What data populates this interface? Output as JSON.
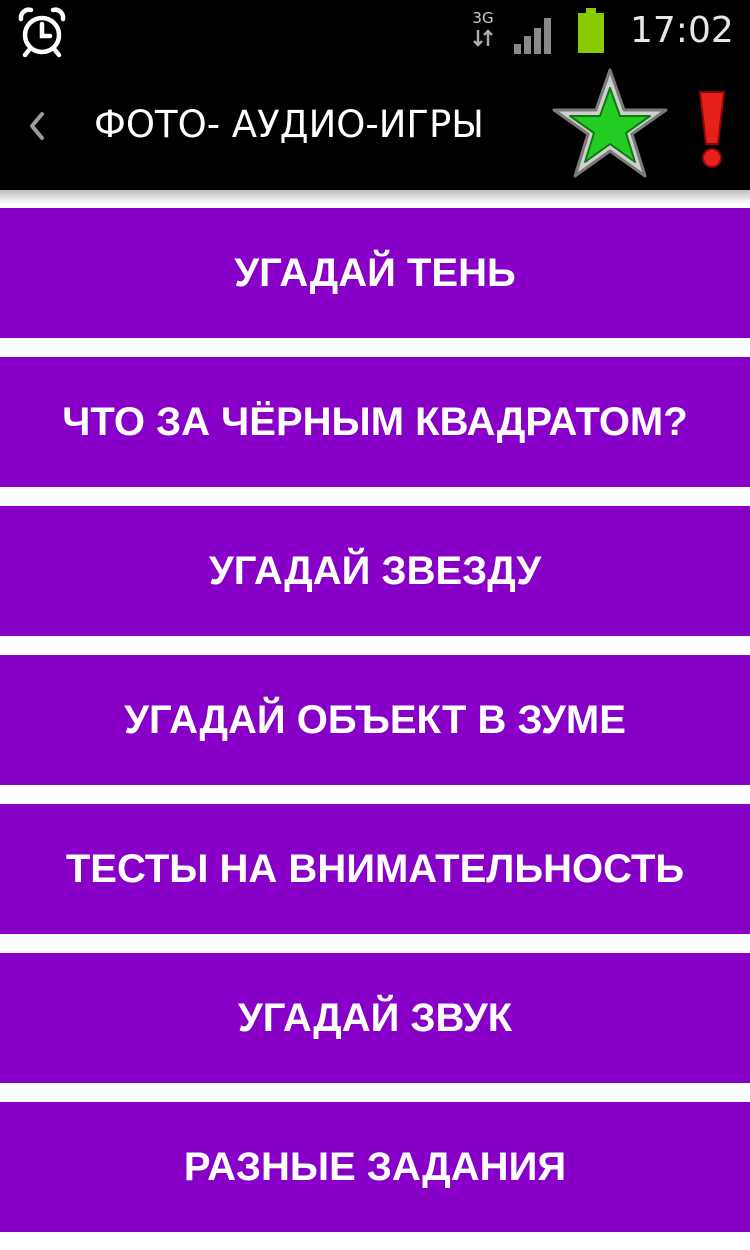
{
  "status_bar": {
    "network_type": "3G",
    "time": "17:02",
    "icons": [
      "alarm-icon",
      "data-arrows-icon",
      "signal-icon",
      "battery-icon"
    ]
  },
  "action_bar": {
    "title": "ФОТО- АУДИО-ИГРЫ",
    "icons": [
      "back-chevron-icon",
      "star-icon",
      "exclamation-icon"
    ]
  },
  "menu": {
    "items": [
      {
        "label": "УГАДАЙ ТЕНЬ"
      },
      {
        "label": "ЧТО ЗА ЧЁРНЫМ КВАДРАТОМ?"
      },
      {
        "label": "УГАДАЙ ЗВЕЗДУ"
      },
      {
        "label": "УГАДАЙ ОБЪЕКТ В ЗУМЕ"
      },
      {
        "label": "ТЕСТЫ НА ВНИМАТЕЛЬНОСТЬ"
      },
      {
        "label": "УГАДАЙ ЗВУК"
      },
      {
        "label": "РАЗНЫЕ ЗАДАНИЯ"
      }
    ]
  },
  "colors": {
    "menu_background": "#8800c8",
    "menu_text": "#ffffff",
    "bar_background": "#000000",
    "star_fill": "#22cc22",
    "alert_red": "#e8201a",
    "battery_green": "#88cc00"
  }
}
